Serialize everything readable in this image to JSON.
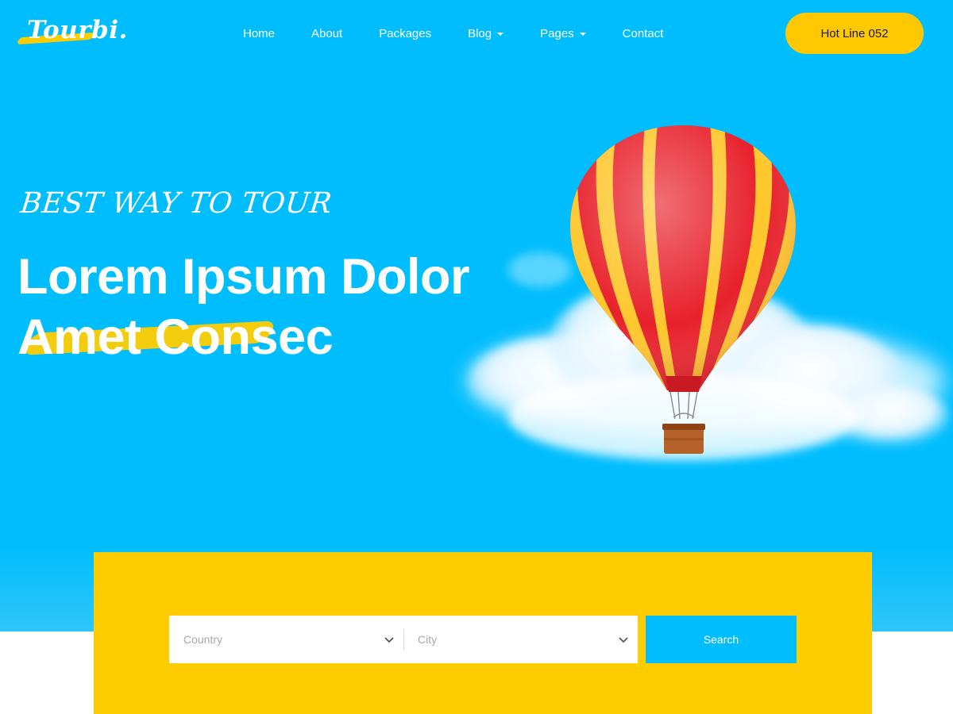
{
  "brand": {
    "logo_text": "Tourbi."
  },
  "nav": {
    "items": [
      {
        "label": "Home",
        "has_dropdown": false
      },
      {
        "label": "About",
        "has_dropdown": false
      },
      {
        "label": "Packages",
        "has_dropdown": false
      },
      {
        "label": "Blog",
        "has_dropdown": true
      },
      {
        "label": "Pages",
        "has_dropdown": true
      },
      {
        "label": "Contact",
        "has_dropdown": false
      }
    ],
    "hotline_label": "Hot Line 052"
  },
  "hero": {
    "tagline": "BEST WAY TO TOUR",
    "headline_line1": "Lorem Ipsum Dolor",
    "headline_line2": "Amet Consec",
    "illustration": "hot-air-balloon-with-cloud"
  },
  "search": {
    "country_placeholder": "Country",
    "city_placeholder": "City",
    "button_label": "Search"
  },
  "colors": {
    "hero_background": "#00bdfe",
    "accent_yellow": "#ffcc00",
    "button_yellow": "#ffc800",
    "search_button": "#00bdfe",
    "text_white": "#ffffff"
  }
}
